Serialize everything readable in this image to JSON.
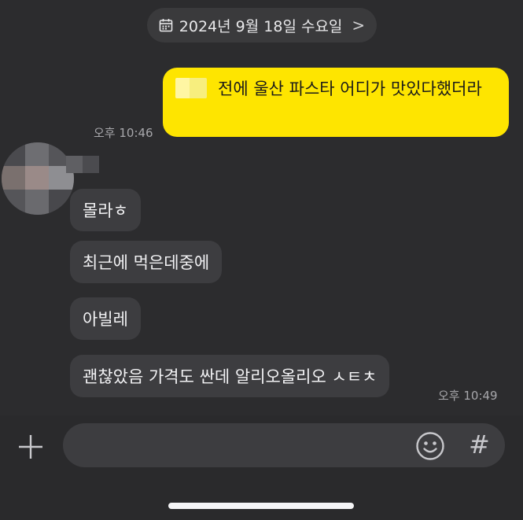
{
  "date_header": {
    "label": "2024년 9월 18일 수요일",
    "chevron": ">",
    "icon": "calendar-icon"
  },
  "messages": {
    "outgoing": {
      "text": "전에 울산 파스타 어디가 맛있다했더라",
      "time": "오후 10:46"
    },
    "incoming": [
      {
        "text": "몰라ㅎ"
      },
      {
        "text": "최근에 먹은데중에"
      },
      {
        "text": "아빌레"
      },
      {
        "text": "괜찮았음 가격도 싼데 알리오올리오 ㅅㅌㅊ"
      }
    ],
    "incoming_time": "오후 10:49"
  },
  "input_bar": {
    "hash_label": "#",
    "icons": [
      "plus-icon",
      "emoji-icon",
      "hash-icon"
    ]
  },
  "colors": {
    "bubble_out": "#fee500",
    "bubble_in": "#3d3d40",
    "background": "#2c2c2e"
  }
}
